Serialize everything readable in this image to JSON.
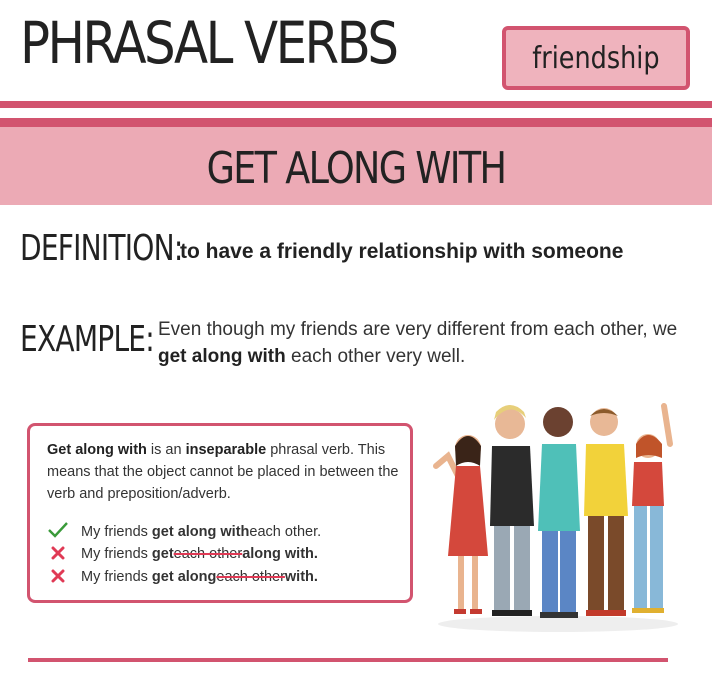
{
  "header": {
    "title": "PHRASAL VERBS",
    "tag": "friendship"
  },
  "band": {
    "title": "GET ALONG WITH"
  },
  "definition": {
    "label": "DEFINITION:",
    "text": "to have a friendly relationship with someone"
  },
  "example": {
    "label": "EXAMPLE:",
    "pre": "Even though my friends are very different from each other, we ",
    "bold": "get along with",
    "post": " each other very well."
  },
  "note": {
    "p1_bold": "Get along with",
    "p1_a": " is an ",
    "p1_bold2": "inseparable",
    "p1_b": " phrasal verb. This means that the object cannot be placed in between the verb and preposition/adverb.",
    "r1_a": "My friends ",
    "r1_b": "get along with",
    "r1_c": " each other.",
    "r2_a": "My friends ",
    "r2_b": "get",
    "r2_c": " each other ",
    "r2_d": "along with.",
    "r3_a": "My friends ",
    "r3_b": "get along",
    "r3_c": " each other ",
    "r3_d": "with.",
    "icon_ok": "check-icon",
    "icon_bad": "cross-icon"
  },
  "colors": {
    "accent": "#d2546f",
    "band": "#ecaab5",
    "tag_bg": "#efb3bd",
    "check": "#3a9a3a",
    "cross": "#e03a55"
  }
}
